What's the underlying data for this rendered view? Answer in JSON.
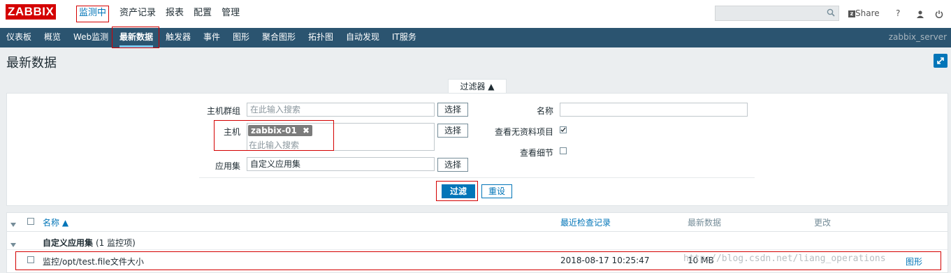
{
  "logo": "ZABBIX",
  "topnav": [
    "监测中",
    "资产记录",
    "报表",
    "配置",
    "管理"
  ],
  "search": {
    "placeholder": ""
  },
  "topright": {
    "share": "Share",
    "help": "?"
  },
  "menu": [
    "仪表板",
    "概览",
    "Web监测",
    "最新数据",
    "触发器",
    "事件",
    "图形",
    "聚合图形",
    "拓扑图",
    "自动发现",
    "IT服务"
  ],
  "server_name": "zabbix_server",
  "page_title": "最新数据",
  "filter": {
    "toggle_label": "过滤器 ▲",
    "host_group_label": "主机群组",
    "host_group_placeholder": "在此输入搜索",
    "host_label": "主机",
    "host_tag": "zabbix-01",
    "host_placeholder": "在此输入搜索",
    "app_label": "应用集",
    "app_value": "自定义应用集",
    "select_label": "选择",
    "name_label": "名称",
    "show_nodata_label": "查看无资料项目",
    "show_nodata_checked": true,
    "show_details_label": "查看细节",
    "show_details_checked": false,
    "filter_button": "过滤",
    "reset_button": "重设"
  },
  "table": {
    "headers": {
      "name": "名称 ▲",
      "last_check": "最近检查记录",
      "last_value": "最新数据",
      "change": "更改"
    },
    "group_row": {
      "name": "自定义应用集",
      "count": "(1 监控项)"
    },
    "rows": [
      {
        "name": "监控/opt/test.file文件大小",
        "last_check": "2018-08-17 10:25:47",
        "last_value": "10 MB",
        "graph": "图形"
      }
    ]
  },
  "watermark": "http://blog.csdn.net/liang_operations",
  "colors": {
    "brand": "#d40000",
    "menu_bg": "#2b5470",
    "accent": "#0275b8"
  }
}
